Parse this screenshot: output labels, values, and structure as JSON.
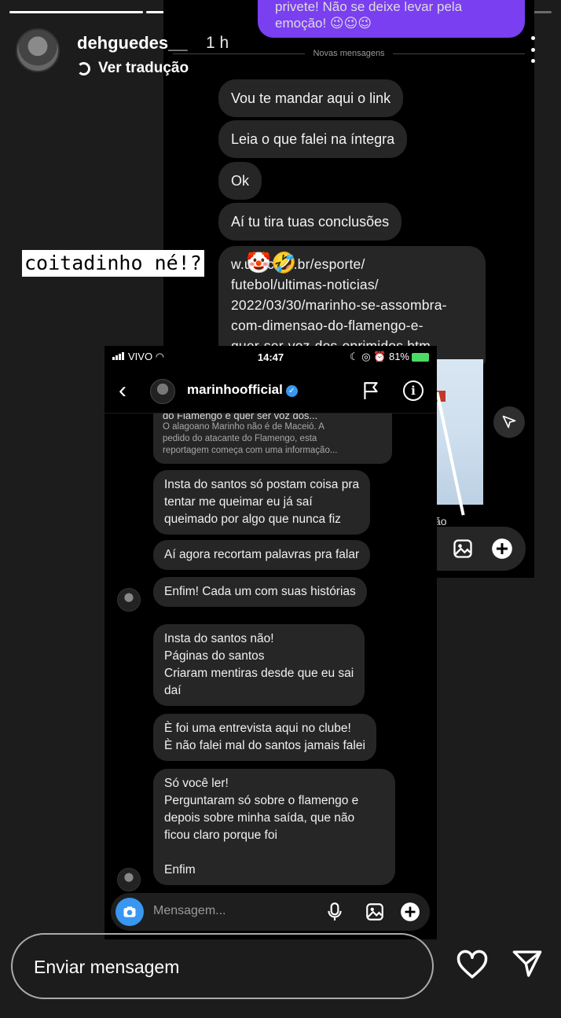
{
  "story": {
    "segments": 4,
    "segments_done": 2,
    "username": "dehguedes__",
    "time_ago": "1 h",
    "translate_label": "Ver tradução",
    "sticker_text": "coitadinho né!?",
    "sticker_emojis": "🤡🤣",
    "reply_placeholder": "Enviar mensagem"
  },
  "back_screenshot": {
    "top_bubble": "privete! Não se deixe levar pela emoção! 😉😉😉",
    "divider_label": "Novas mensagens",
    "messages": [
      "Vou te mandar aqui o link",
      "Leia o que falei na íntegra",
      "Ok",
      "Aí tu tira tuas conclusões"
    ],
    "link_text": "www.uol.com.br/esporte/futebol/ultimas-noticias/2022/03/30/marinho-se-assombra-com-dimensao-do-flamengo-e-quer-ser-voz-dos-oprimidos.htm",
    "link_lines": [
      "w.uol.com.br/esporte/",
      "futebol/ultimas-noticias/",
      "2022/03/30/marinho-se-assombra-",
      "com-dimensao-do-flamengo-e-",
      "quer-ser-voz-dos-oprimidos.htm"
    ],
    "link_tail": "ão"
  },
  "front_screenshot": {
    "status": {
      "carrier": "VIVO",
      "time": "14:47",
      "battery": "81%"
    },
    "contact_name": "marinhoofficial",
    "preview": {
      "title": "do Flamengo e quer ser voz dos...",
      "lines": [
        "O alagoano Marinho não é de Maceió. A",
        "pedido do atacante do Flamengo, esta",
        "reportagem começa com uma informação..."
      ]
    },
    "messages": [
      [
        "Insta do santos só postam coisa pra",
        "tentar me queimar eu já saí",
        "queimado por algo que nunca fiz"
      ],
      [
        "Aí agora recortam palavras pra falar"
      ],
      [
        "Enfim! Cada um com suas histórias"
      ],
      [
        "Insta do santos não!",
        "Páginas do santos",
        "Criaram mentiras desde que eu sai",
        "daí"
      ],
      [
        "È foi uma entrevista aqui no clube!",
        "È não falei mal do santos jamais falei"
      ],
      [
        "Só você ler!",
        "Perguntaram só sobre o flamengo e",
        "depois sobre minha saída, que não",
        "ficou claro porque foi",
        "",
        "Enfim"
      ]
    ],
    "composer_placeholder": "Mensagem..."
  },
  "colors": {
    "accent_purple": "#7a3ff0",
    "bubble": "#262626",
    "blue": "#3897f0"
  }
}
